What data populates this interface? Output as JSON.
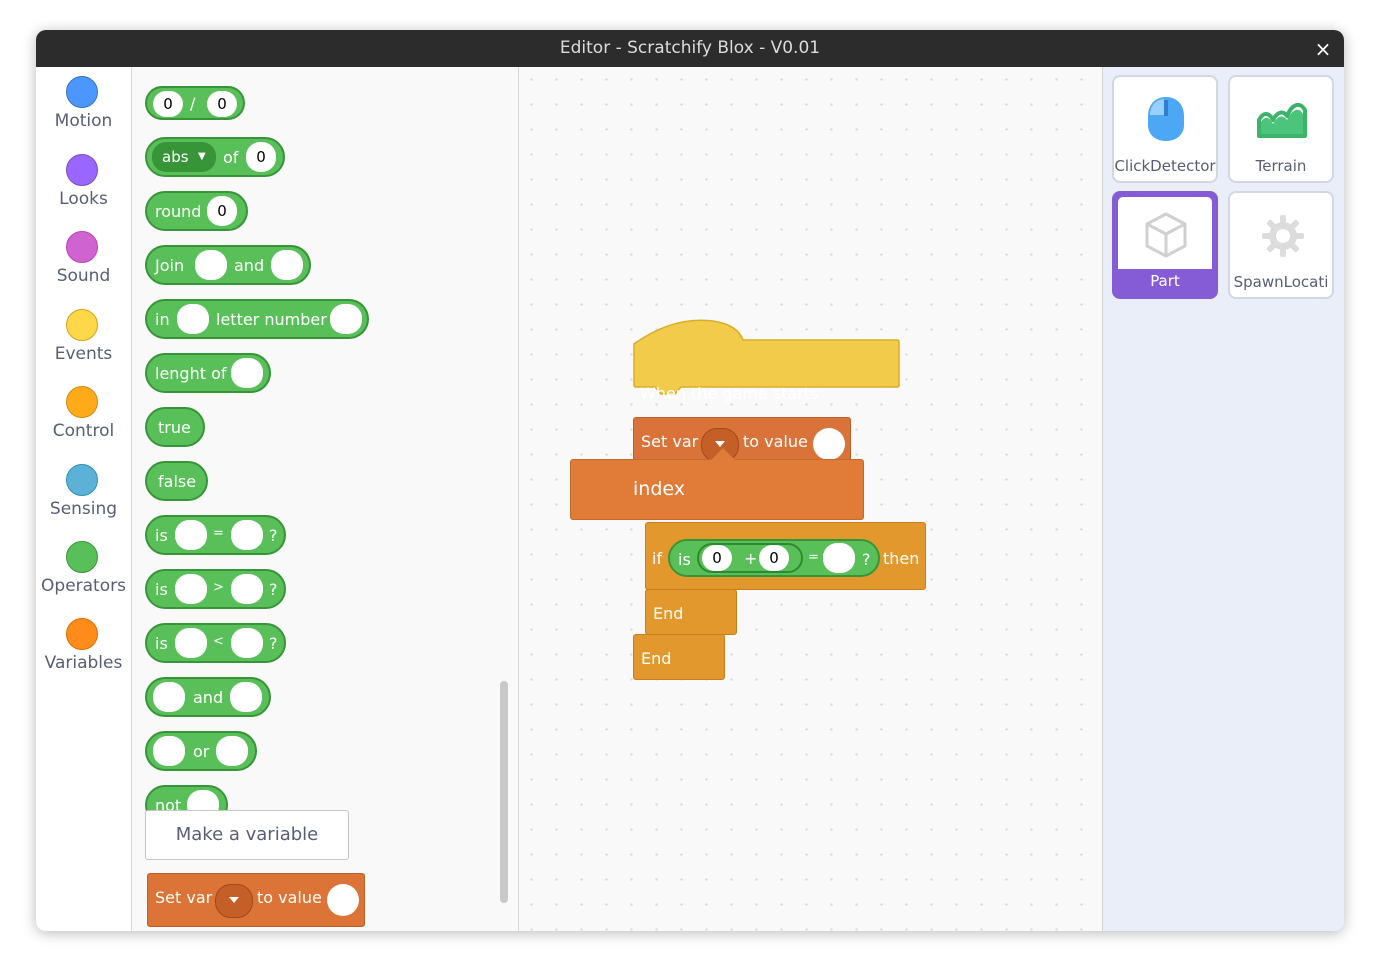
{
  "window": {
    "title": "Editor - Scratchify Blox - V0.01",
    "close_glyph": "×"
  },
  "categories": [
    {
      "label": "Motion",
      "color": "#4c97ff"
    },
    {
      "label": "Looks",
      "color": "#9966ff"
    },
    {
      "label": "Sound",
      "color": "#cf63cf"
    },
    {
      "label": "Events",
      "color": "#ffd500"
    },
    {
      "label": "Control",
      "color": "#ffab19"
    },
    {
      "label": "Sensing",
      "color": "#5cb1d6"
    },
    {
      "label": "Operators",
      "color": "#59c059"
    },
    {
      "label": "Variables",
      "color": "#ff8c1a"
    }
  ],
  "palette": {
    "divide": {
      "left": "0",
      "op": "/",
      "right": "0"
    },
    "abs_of": {
      "dropdown": "abs",
      "word": "of",
      "value": "0"
    },
    "round": {
      "word": "round",
      "value": "0"
    },
    "join": {
      "word": "Join",
      "and": "and"
    },
    "letter": {
      "in": "in",
      "word": "letter number"
    },
    "length": {
      "word": "lenght of"
    },
    "true_label": "true",
    "false_label": "false",
    "equals": {
      "is": "is",
      "op": "=",
      "q": "?"
    },
    "greater": {
      "is": "is",
      "op": ">",
      "q": "?"
    },
    "less": {
      "is": "is",
      "op": "<",
      "q": "?"
    },
    "and_label": "and",
    "or_label": "or",
    "not_label": "not",
    "make_variable": "Make a variable",
    "set_var": {
      "label": "Set var",
      "to_value": "to value"
    }
  },
  "script": {
    "hat": "When the game starts",
    "set_var": {
      "label": "Set var",
      "to_value": "to value"
    },
    "if_block": {
      "if": "if",
      "is": "is",
      "a": "0",
      "plus": "+",
      "b": "0",
      "eq": "=",
      "q": "?",
      "then": "then"
    },
    "end1": "End",
    "end2": "End"
  },
  "dropdown_menu": {
    "items": [
      "index"
    ]
  },
  "sprites": [
    {
      "name": "ClickDetector",
      "icon": "mouse-icon",
      "selected": false
    },
    {
      "name": "Terrain",
      "icon": "terrain-icon",
      "selected": false
    },
    {
      "name": "Part",
      "icon": "cube-icon",
      "selected": true
    },
    {
      "name": "SpawnLocati",
      "icon": "spawn-gear-icon",
      "selected": false
    }
  ]
}
